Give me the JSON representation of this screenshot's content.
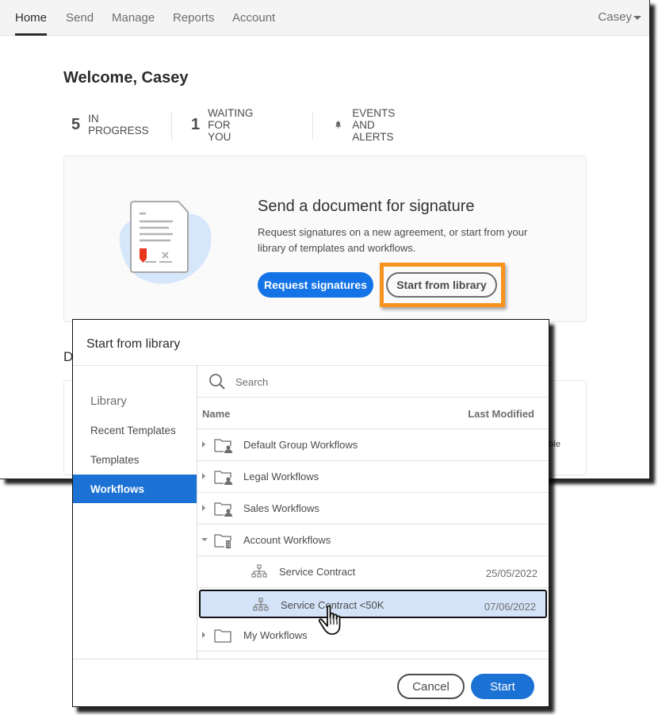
{
  "nav": {
    "items": [
      {
        "label": "Home",
        "active": true
      },
      {
        "label": "Send"
      },
      {
        "label": "Manage"
      },
      {
        "label": "Reports"
      },
      {
        "label": "Account"
      }
    ],
    "user": "Casey"
  },
  "welcome": "Welcome, Casey",
  "stats": [
    {
      "count": "5",
      "label": "IN PROGRESS"
    },
    {
      "count": "1",
      "label": "WAITING FOR YOU"
    },
    {
      "icon": "bell-icon",
      "label": "EVENTS AND ALERTS"
    }
  ],
  "send_card": {
    "title": "Send a document for signature",
    "description": "Request signatures on a new agreement, or start from your library of templates and workflows.",
    "primary_button": "Request signatures",
    "secondary_button": "Start from library",
    "highlight_color": "#f7931e"
  },
  "partial": {
    "section_letter": "D",
    "card_text_fragment": "ble"
  },
  "dialog": {
    "title": "Start from library",
    "sidebar": {
      "heading": "Library",
      "items": [
        {
          "label": "Recent Templates"
        },
        {
          "label": "Templates"
        },
        {
          "label": "Workflows",
          "active": true
        }
      ]
    },
    "search_placeholder": "Search",
    "columns": {
      "name": "Name",
      "modified": "Last Modified"
    },
    "rows": [
      {
        "name": "Default Group Workflows",
        "type": "group-folder",
        "expanded": false,
        "date": ""
      },
      {
        "name": "Legal Workflows",
        "type": "group-folder",
        "expanded": false,
        "date": ""
      },
      {
        "name": "Sales Workflows",
        "type": "group-folder",
        "expanded": false,
        "date": ""
      },
      {
        "name": "Account Workflows",
        "type": "account-folder",
        "expanded": true,
        "date": ""
      },
      {
        "name": "Service Contract",
        "type": "workflow",
        "date": "25/05/2022"
      },
      {
        "name": "Service Contract <50K",
        "type": "workflow",
        "date": "07/06/2022",
        "selected": true
      },
      {
        "name": "My Workflows",
        "type": "folder",
        "expanded": false,
        "date": ""
      }
    ],
    "cancel": "Cancel",
    "start": "Start"
  },
  "colors": {
    "accent": "#1473e6",
    "dialog_accent": "#1c72d4",
    "selected_row": "#d4e3f7"
  }
}
